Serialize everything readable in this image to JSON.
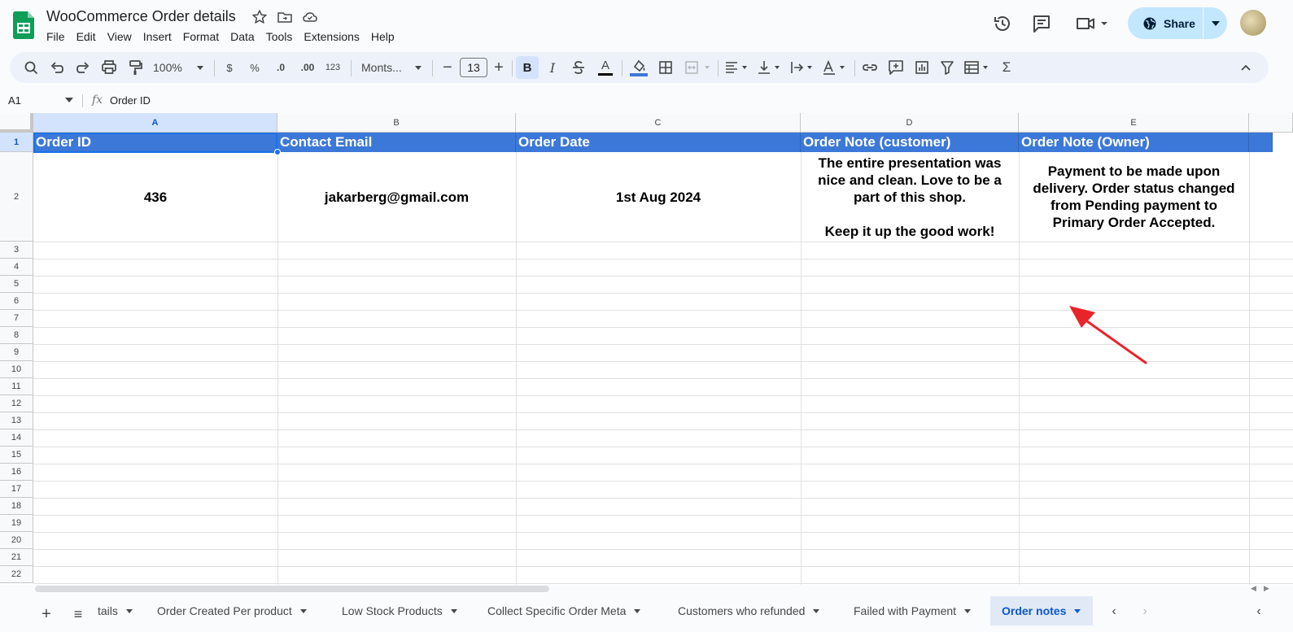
{
  "app": {
    "title": "WooCommerce Order details",
    "menu": [
      "File",
      "Edit",
      "View",
      "Insert",
      "Format",
      "Data",
      "Tools",
      "Extensions",
      "Help"
    ],
    "share_label": "Share"
  },
  "toolbar": {
    "zoom": "100%",
    "currency": "$",
    "percent": "%",
    "dec_decrease": ".0",
    "dec_increase": ".00",
    "number_format": "123",
    "font": "Monts...",
    "font_size": "13",
    "bold": "B",
    "italic": "I",
    "text_color": "A",
    "sum": "Σ"
  },
  "formula_bar": {
    "cell_ref": "A1",
    "fx": "fx",
    "value": "Order ID"
  },
  "grid": {
    "columns": [
      "A",
      "B",
      "C",
      "D",
      "E"
    ],
    "rows": [
      "1",
      "2",
      "3",
      "4",
      "5",
      "6",
      "7",
      "8",
      "9",
      "10",
      "11",
      "12",
      "13",
      "14",
      "15",
      "16",
      "17",
      "18",
      "19",
      "20",
      "21",
      "22"
    ],
    "header": [
      "Order ID",
      "Contact Email",
      "Order Date",
      "Order Note (customer)",
      "Order Note (Owner)"
    ],
    "row2": [
      "436",
      "jakarberg@gmail.com",
      "1st Aug 2024",
      "The entire presentation was nice and clean. Love to be a part of this shop.\n\nKeep it up the good work!",
      "Payment to be made upon delivery. Order status changed from Pending payment to Primary Order Accepted."
    ],
    "header_color": "#3c78d8"
  },
  "sheets": {
    "tabs": [
      "tails",
      "Order Created Per product",
      "Low Stock Products",
      "Collect Specific Order Meta",
      "Customers who refunded",
      "Failed with Payment",
      "Order notes"
    ],
    "active": "Order notes",
    "add": "+",
    "all": "≡"
  },
  "colors": {
    "accent": "#0b57d0",
    "share_bg": "#c2e7ff",
    "arrow": "#e8242a"
  }
}
